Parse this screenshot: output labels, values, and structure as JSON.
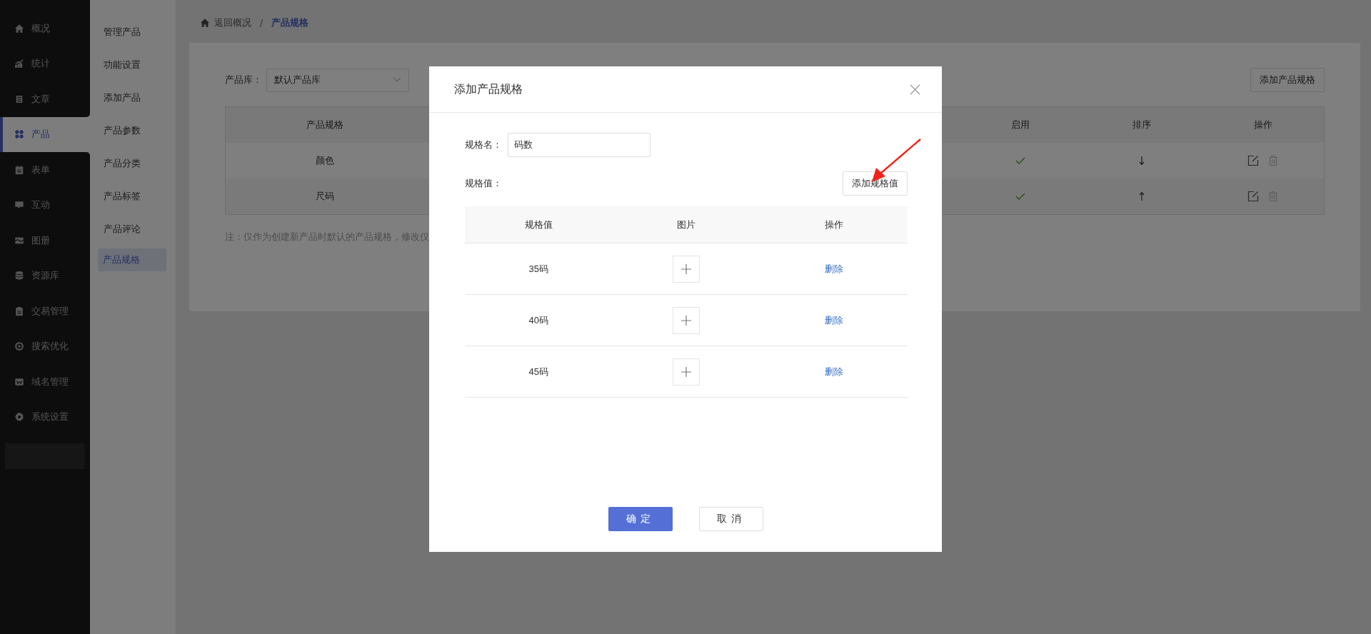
{
  "sidebar": {
    "items": [
      {
        "label": "概况",
        "kind": "home",
        "selected": false
      },
      {
        "label": "统计",
        "kind": "chart",
        "selected": false
      },
      {
        "label": "文章",
        "kind": "doc",
        "selected": false
      },
      {
        "label": "产品",
        "kind": "grid",
        "selected": true
      },
      {
        "label": "表单",
        "kind": "form",
        "selected": false
      },
      {
        "label": "互动",
        "kind": "chat",
        "selected": false
      },
      {
        "label": "图册",
        "kind": "image",
        "selected": false
      },
      {
        "label": "资源库",
        "kind": "database",
        "selected": false
      },
      {
        "label": "交易管理",
        "kind": "clipboard",
        "selected": false
      },
      {
        "label": "搜索优化",
        "kind": "ring",
        "selected": false
      },
      {
        "label": "域名管理",
        "kind": "web",
        "selected": false
      },
      {
        "label": "系统设置",
        "kind": "gear",
        "selected": false
      }
    ]
  },
  "subnav": {
    "items": [
      {
        "label": "管理产品",
        "selected": false
      },
      {
        "label": "功能设置",
        "selected": false
      },
      {
        "label": "添加产品",
        "selected": false
      },
      {
        "label": "产品参数",
        "selected": false
      },
      {
        "label": "产品分类",
        "selected": false
      },
      {
        "label": "产品标签",
        "selected": false
      },
      {
        "label": "产品评论",
        "selected": false
      },
      {
        "label": "产品规格",
        "selected": true
      }
    ]
  },
  "breadcrumb": {
    "back": "返回概况",
    "separator": "/",
    "current": "产品规格"
  },
  "filter": {
    "label": "产品库：",
    "value": "默认产品库"
  },
  "add_button": "添加产品规格",
  "table": {
    "columns": [
      "产品规格",
      "启用",
      "排序",
      "操作"
    ],
    "rows": [
      {
        "name": "颜色",
        "enabled": true,
        "kind": "down"
      },
      {
        "name": "尺码",
        "enabled": true,
        "kind": "up"
      }
    ]
  },
  "note": "注：仅作为创建新产品时默认的产品规格，修改仅",
  "dialog": {
    "title": "添加产品规格",
    "name_label": "规格名：",
    "name_value": "码数",
    "values_label": "规格值：",
    "add_value_button": "添加规格值",
    "columns": [
      "规格值",
      "图片",
      "操作"
    ],
    "rows": [
      {
        "value": "35码",
        "action": "删除"
      },
      {
        "value": "40码",
        "action": "删除"
      },
      {
        "value": "45码",
        "action": "删除"
      }
    ],
    "confirm": "确定",
    "cancel": "取消"
  }
}
